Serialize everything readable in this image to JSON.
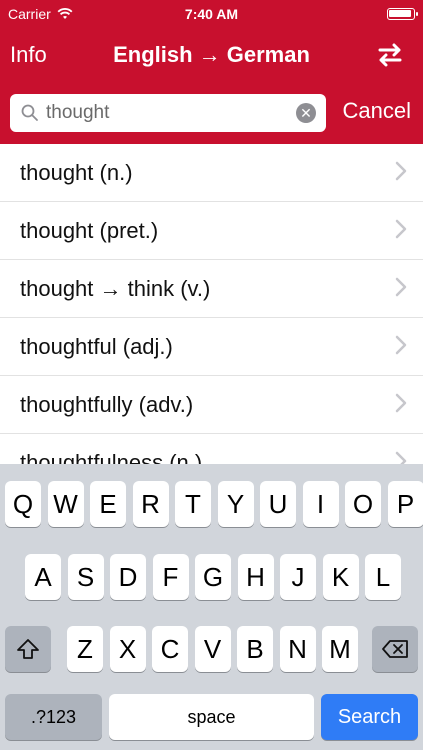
{
  "status_bar": {
    "carrier": "Carrier",
    "time": "7:40 AM",
    "battery_level": 0.95
  },
  "nav": {
    "info_label": "Info",
    "title": "English → German"
  },
  "search": {
    "value": "thought",
    "cancel_label": "Cancel"
  },
  "results": [
    {
      "label": "thought (n.)"
    },
    {
      "label": "thought (pret.)"
    },
    {
      "label": "thought → think (v.)"
    },
    {
      "label": "thoughtful (adj.)"
    },
    {
      "label": "thoughtfully (adv.)"
    },
    {
      "label": "thoughtfulness (n.)"
    }
  ],
  "keyboard": {
    "row1": [
      "Q",
      "W",
      "E",
      "R",
      "T",
      "Y",
      "U",
      "I",
      "O",
      "P"
    ],
    "row2": [
      "A",
      "S",
      "D",
      "F",
      "G",
      "H",
      "J",
      "K",
      "L"
    ],
    "row3": [
      "Z",
      "X",
      "C",
      "V",
      "B",
      "N",
      "M"
    ],
    "numbers_label": ".?123",
    "space_label": "space",
    "search_label": "Search"
  },
  "colors": {
    "brand": "#c8102e",
    "keyboard_bg": "#d1d5db",
    "search_key": "#2f7cf6"
  }
}
